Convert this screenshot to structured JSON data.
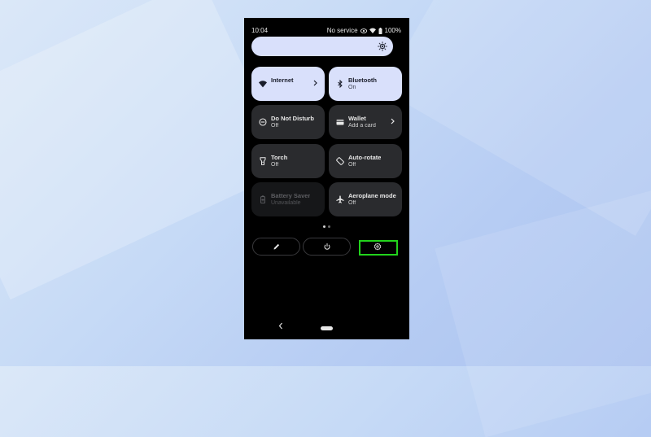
{
  "status_bar": {
    "time": "10:04",
    "carrier": "No service",
    "battery": "100%"
  },
  "brightness": {
    "icon": "brightness-icon"
  },
  "tiles": [
    {
      "title": "Internet",
      "subtitle": "",
      "state": "active",
      "icon": "wifi-icon",
      "chevron": true
    },
    {
      "title": "Bluetooth",
      "subtitle": "On",
      "state": "active",
      "icon": "bluetooth-icon",
      "chevron": false
    },
    {
      "title": "Do Not Disturb",
      "subtitle": "Off",
      "state": "inactive",
      "icon": "do-not-disturb-icon",
      "chevron": false
    },
    {
      "title": "Wallet",
      "subtitle": "Add a card",
      "state": "inactive",
      "icon": "wallet-icon",
      "chevron": true
    },
    {
      "title": "Torch",
      "subtitle": "Off",
      "state": "inactive",
      "icon": "torch-icon",
      "chevron": false
    },
    {
      "title": "Auto-rotate",
      "subtitle": "Off",
      "state": "inactive",
      "icon": "auto-rotate-icon",
      "chevron": false
    },
    {
      "title": "Battery Saver",
      "subtitle": "Unavailable",
      "state": "disabled",
      "icon": "battery-saver-icon",
      "chevron": false
    },
    {
      "title": "Aeroplane mode",
      "subtitle": "Off",
      "state": "inactive",
      "icon": "aeroplane-icon",
      "chevron": false
    }
  ],
  "page_indicator": {
    "pages": 2,
    "current": 1
  },
  "bottom_actions": [
    {
      "icon": "edit-pencil-icon"
    },
    {
      "icon": "power-icon"
    },
    {
      "icon": "settings-gear-icon",
      "highlighted": true
    }
  ],
  "colors": {
    "active_tile": "#d9e0fb",
    "inactive_tile": "#2a2b2e",
    "highlight": "#22d31c"
  }
}
